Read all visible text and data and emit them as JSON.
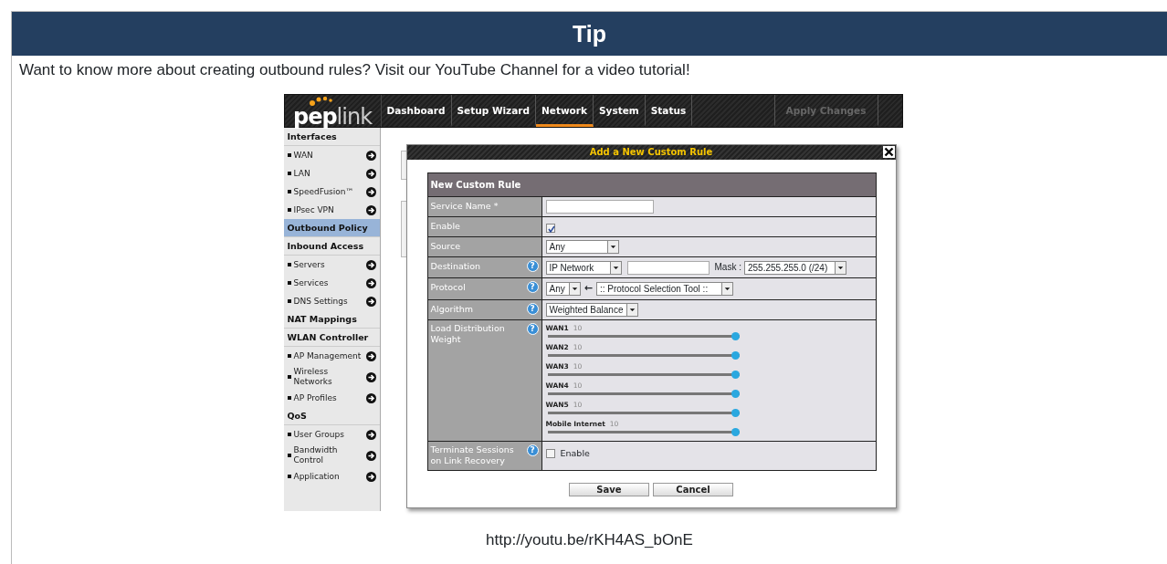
{
  "tip": {
    "title": "Tip",
    "text": "Want to know more about creating outbound rules? Visit our YouTube Channel for a video tutorial!",
    "link": "http://youtu.be/rKH4AS_bOnE"
  },
  "screenshot": {
    "logo": [
      "pep",
      "link"
    ],
    "nav": [
      {
        "label": "Dashboard",
        "selected": false,
        "disabled": false
      },
      {
        "label": "Setup Wizard",
        "selected": false,
        "disabled": false
      },
      {
        "label": "Network",
        "selected": true,
        "disabled": false
      },
      {
        "label": "System",
        "selected": false,
        "disabled": false
      },
      {
        "label": "Status",
        "selected": false,
        "disabled": false
      }
    ],
    "apply": {
      "label": "Apply Changes",
      "disabled": true
    },
    "sidebar": [
      {
        "kind": "header",
        "label": "Interfaces",
        "selected": false
      },
      {
        "kind": "item",
        "label": "WAN",
        "selected": false
      },
      {
        "kind": "item",
        "label": "LAN",
        "selected": false
      },
      {
        "kind": "item",
        "label": "SpeedFusion™",
        "selected": false
      },
      {
        "kind": "item",
        "label": "IPsec VPN",
        "selected": false
      },
      {
        "kind": "header",
        "label": "Outbound Policy",
        "selected": true
      },
      {
        "kind": "header",
        "label": "Inbound Access",
        "selected": false
      },
      {
        "kind": "item",
        "label": "Servers",
        "selected": false
      },
      {
        "kind": "item",
        "label": "Services",
        "selected": false
      },
      {
        "kind": "item",
        "label": "DNS Settings",
        "selected": false
      },
      {
        "kind": "header",
        "label": "NAT Mappings",
        "selected": false
      },
      {
        "kind": "header",
        "label": "WLAN Controller",
        "selected": false
      },
      {
        "kind": "item",
        "label": "AP Management",
        "selected": false
      },
      {
        "kind": "item",
        "label": "Wireless Networks",
        "selected": false
      },
      {
        "kind": "item",
        "label": "AP Profiles",
        "selected": false
      },
      {
        "kind": "header",
        "label": "QoS",
        "selected": false
      },
      {
        "kind": "item",
        "label": "User Groups",
        "selected": false
      },
      {
        "kind": "item",
        "label": "Bandwidth Control",
        "selected": false
      },
      {
        "kind": "item",
        "label": "Application",
        "selected": false
      }
    ],
    "dialog": {
      "title": "Add a New Custom Rule",
      "heading": "New Custom Rule",
      "rows": [
        {
          "kind": "text",
          "label": "Service Name *"
        },
        {
          "kind": "checkbox",
          "label": "Enable",
          "checked": true
        },
        {
          "kind": "select",
          "label": "Source",
          "value": "Any"
        },
        {
          "kind": "destination",
          "label": "Destination",
          "help": "?",
          "value": "IP Network",
          "mask_label": "Mask :",
          "mask": "255.255.255.0 (/24)"
        },
        {
          "kind": "protocol",
          "label": "Protocol",
          "help": "?",
          "value": "Any",
          "arrow": "←",
          "tool": ":: Protocol Selection Tool ::"
        },
        {
          "kind": "select",
          "label": "Algorithm",
          "help": "?",
          "value": "Weighted Balance"
        },
        {
          "kind": "sliders",
          "label": "Load Distribution Weight",
          "help": "?",
          "sliders": [
            {
              "name": "WAN1",
              "value": "10",
              "level": 1
            },
            {
              "name": "WAN2",
              "value": "10",
              "level": 1
            },
            {
              "name": "WAN3",
              "value": "10",
              "level": 1
            },
            {
              "name": "WAN4",
              "value": "10",
              "level": 1
            },
            {
              "name": "WAN5",
              "value": "10",
              "level": 1
            },
            {
              "name": "Mobile Internet",
              "value": "10",
              "level": 1
            }
          ]
        },
        {
          "kind": "checkbox",
          "label": "Terminate Sessions on Link Recovery",
          "help": "?",
          "checked": false,
          "text": "Enable"
        }
      ],
      "buttons": [
        "Save",
        "Cancel"
      ]
    }
  }
}
